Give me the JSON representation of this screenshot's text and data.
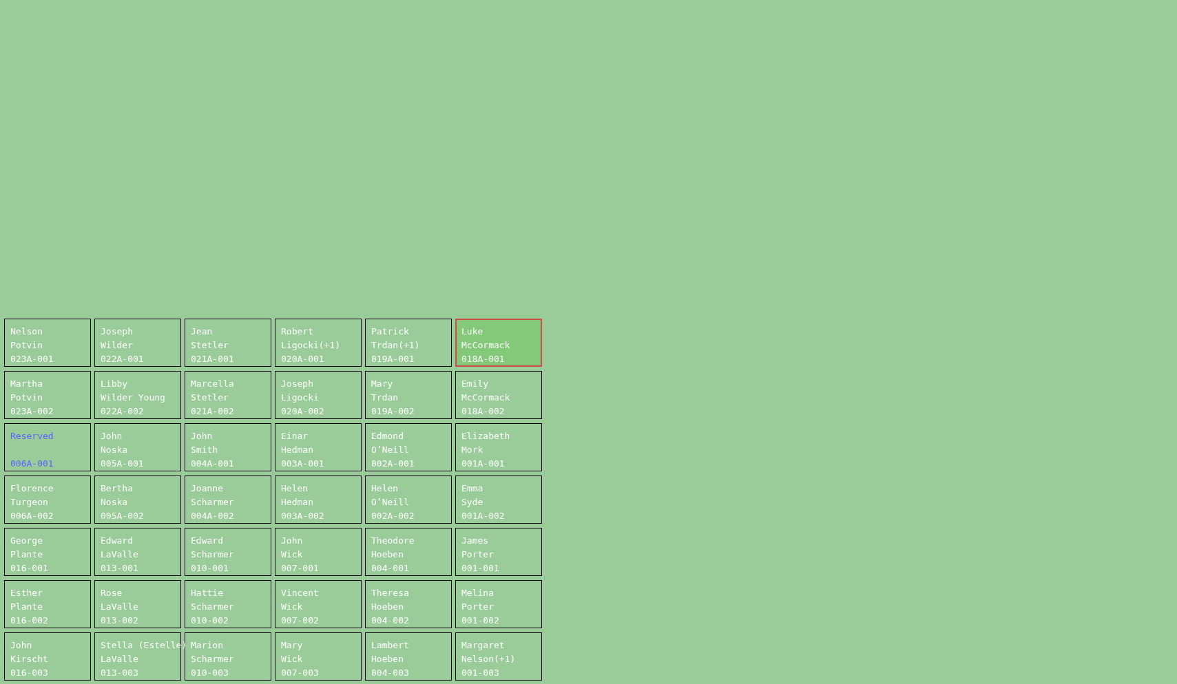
{
  "plots": [
    {
      "kind": "guest",
      "first": "Nelson",
      "last": "Potvin",
      "code": "023A-001",
      "selected": false
    },
    {
      "kind": "guest",
      "first": "Joseph",
      "last": "Wilder",
      "code": "022A-001",
      "selected": false
    },
    {
      "kind": "guest",
      "first": "Jean",
      "last": "Stetler",
      "code": "021A-001",
      "selected": false
    },
    {
      "kind": "guest",
      "first": "Robert",
      "last": "Ligocki(+1)",
      "code": "020A-001",
      "selected": false
    },
    {
      "kind": "guest",
      "first": "Patrick",
      "last": "Trdan(+1)",
      "code": "019A-001",
      "selected": false
    },
    {
      "kind": "guest",
      "first": "Luke",
      "last": "McCormack",
      "code": "018A-001",
      "selected": true
    },
    {
      "kind": "guest",
      "first": "Martha",
      "last": "Potvin",
      "code": "023A-002",
      "selected": false
    },
    {
      "kind": "guest",
      "first": "Libby",
      "last": "Wilder Young",
      "code": "022A-002",
      "selected": false
    },
    {
      "kind": "guest",
      "first": "Marcella",
      "last": "Stetler",
      "code": "021A-002",
      "selected": false
    },
    {
      "kind": "guest",
      "first": "Joseph",
      "last": "Ligocki",
      "code": "020A-002",
      "selected": false
    },
    {
      "kind": "guest",
      "first": "Mary",
      "last": "Trdan",
      "code": "019A-002",
      "selected": false
    },
    {
      "kind": "guest",
      "first": "Emily",
      "last": "McCormack",
      "code": "018A-002",
      "selected": false
    },
    {
      "kind": "reserved",
      "first": "Reserved",
      "code": "006A-001",
      "selected": false
    },
    {
      "kind": "guest",
      "first": "John",
      "last": "Noska",
      "code": "005A-001",
      "selected": false
    },
    {
      "kind": "guest",
      "first": "John",
      "last": "Smith",
      "code": "004A-001",
      "selected": false
    },
    {
      "kind": "guest",
      "first": "Einar",
      "last": "Hedman",
      "code": "003A-001",
      "selected": false
    },
    {
      "kind": "guest",
      "first": "Edmond",
      "last": "O’Neill",
      "code": "002A-001",
      "selected": false
    },
    {
      "kind": "guest",
      "first": "Elizabeth",
      "last": "Mork",
      "code": "001A-001",
      "selected": false
    },
    {
      "kind": "guest",
      "first": "Florence",
      "last": "Turgeon",
      "code": "006A-002",
      "selected": false
    },
    {
      "kind": "guest",
      "first": "Bertha",
      "last": "Noska",
      "code": "005A-002",
      "selected": false
    },
    {
      "kind": "guest",
      "first": "Joanne",
      "last": "Scharmer",
      "code": "004A-002",
      "selected": false
    },
    {
      "kind": "guest",
      "first": "Helen",
      "last": "Hedman",
      "code": "003A-002",
      "selected": false
    },
    {
      "kind": "guest",
      "first": "Helen",
      "last": "O’Neill",
      "code": "002A-002",
      "selected": false
    },
    {
      "kind": "guest",
      "first": "Emma",
      "last": "Syde",
      "code": "001A-002",
      "selected": false
    },
    {
      "kind": "guest",
      "first": "George",
      "last": "Plante",
      "code": "016-001",
      "selected": false
    },
    {
      "kind": "guest",
      "first": "Edward",
      "last": "LaValle",
      "code": "013-001",
      "selected": false
    },
    {
      "kind": "guest",
      "first": "Edward",
      "last": "Scharmer",
      "code": "010-001",
      "selected": false
    },
    {
      "kind": "guest",
      "first": "John",
      "last": "Wick",
      "code": "007-001",
      "selected": false
    },
    {
      "kind": "guest",
      "first": "Theodore",
      "last": "Hoeben",
      "code": "004-001",
      "selected": false
    },
    {
      "kind": "guest",
      "first": "James",
      "last": "Porter",
      "code": "001-001",
      "selected": false
    },
    {
      "kind": "guest",
      "first": "Esther",
      "last": "Plante",
      "code": "016-002",
      "selected": false
    },
    {
      "kind": "guest",
      "first": "Rose",
      "last": "LaValle",
      "code": "013-002",
      "selected": false
    },
    {
      "kind": "guest",
      "first": "Hattie",
      "last": "Scharmer",
      "code": "010-002",
      "selected": false
    },
    {
      "kind": "guest",
      "first": "Vincent",
      "last": "Wick",
      "code": "007-002",
      "selected": false
    },
    {
      "kind": "guest",
      "first": "Theresa",
      "last": "Hoeben",
      "code": "004-002",
      "selected": false
    },
    {
      "kind": "guest",
      "first": "Melina",
      "last": "Porter",
      "code": "001-002",
      "selected": false
    },
    {
      "kind": "guest",
      "first": "John",
      "last": "Kirscht",
      "code": "016-003",
      "selected": false
    },
    {
      "kind": "guest",
      "first": "Stella (Estelle)",
      "last": "LaValle",
      "code": "013-003",
      "selected": false
    },
    {
      "kind": "guest",
      "first": "Marion",
      "last": "Scharmer",
      "code": "010-003",
      "selected": false
    },
    {
      "kind": "guest",
      "first": "Mary",
      "last": "Wick",
      "code": "007-003",
      "selected": false
    },
    {
      "kind": "guest",
      "first": "Lambert",
      "last": "Hoeben",
      "code": "004-003",
      "selected": false
    },
    {
      "kind": "guest",
      "first": "Margaret",
      "last": "Nelson(+1)",
      "code": "001-003",
      "selected": false
    }
  ]
}
